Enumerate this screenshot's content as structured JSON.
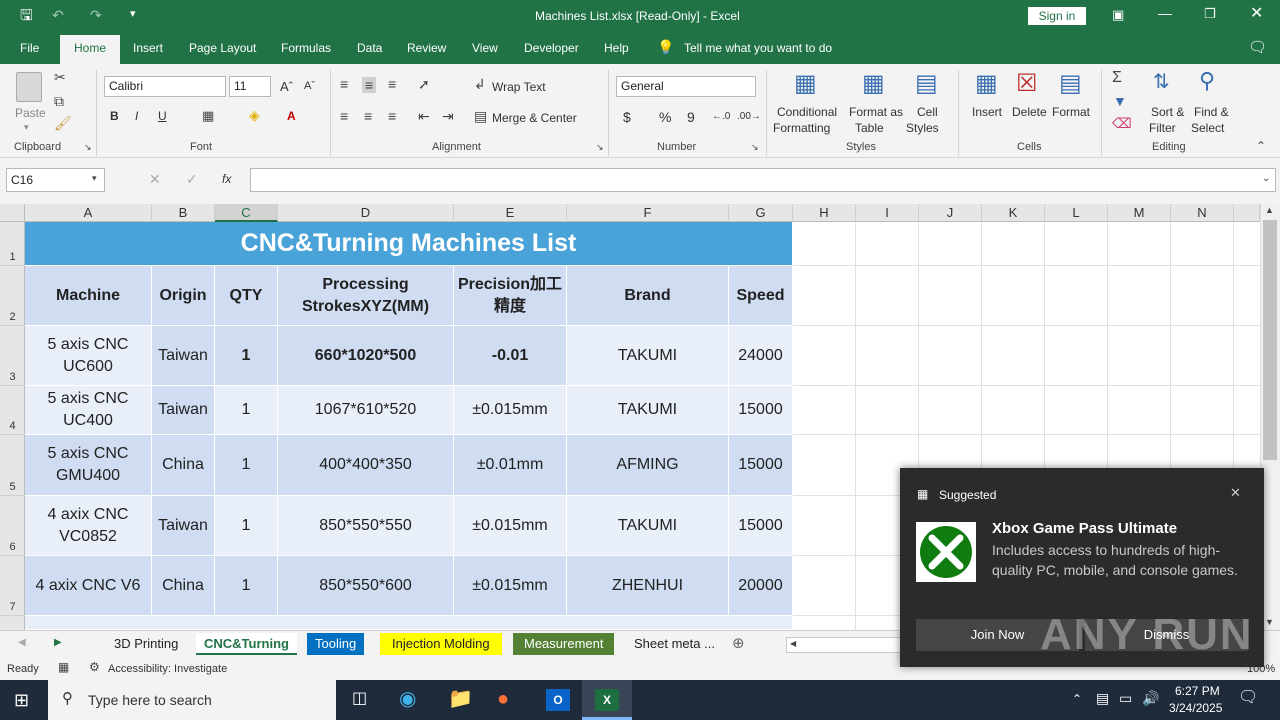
{
  "title": "Machines List.xlsx  [Read-Only]  -  Excel",
  "sign_in": "Sign in",
  "menu_tabs": [
    "File",
    "Home",
    "Insert",
    "Page Layout",
    "Formulas",
    "Data",
    "Review",
    "View",
    "Developer",
    "Help"
  ],
  "tell_me": "Tell me what you want to do",
  "ribbon": {
    "paste": "Paste",
    "font_name": "Calibri",
    "font_size": "11",
    "wrap_text": "Wrap Text",
    "merge_center": "Merge & Center",
    "number_format": "General",
    "conditional": [
      "Conditional",
      "Formatting"
    ],
    "format_table": [
      "Format as",
      "Table"
    ],
    "cell_styles": [
      "Cell",
      "Styles"
    ],
    "insert": "Insert",
    "delete": "Delete",
    "format": "Format",
    "sort_filter": [
      "Sort &",
      "Filter"
    ],
    "find_select": [
      "Find &",
      "Select"
    ],
    "groups": [
      "Clipboard",
      "Font",
      "Alignment",
      "Number",
      "Styles",
      "Cells",
      "Editing"
    ]
  },
  "formula_bar": {
    "name_box": "C16",
    "fx": "fx",
    "formula": ""
  },
  "columns": [
    "A",
    "B",
    "C",
    "D",
    "E",
    "F",
    "G",
    "H",
    "I",
    "J",
    "K",
    "L",
    "M",
    "N"
  ],
  "rows": [
    "1",
    "2",
    "3",
    "4",
    "5",
    "6",
    "7"
  ],
  "sheet": {
    "title": "CNC&Turning Machines List",
    "headers": [
      "Machine",
      "Origin",
      "QTY",
      "Processing StrokesXYZ(MM)",
      "Precision加工精度",
      "Brand",
      "Speed"
    ],
    "data": [
      [
        "5 axis CNC UC600",
        "Taiwan",
        "1",
        "660*1020*500",
        "-0.01",
        "TAKUMI",
        "24000"
      ],
      [
        "5 axis CNC UC400",
        "Taiwan",
        "1",
        "1067*610*520",
        "±0.015mm",
        "TAKUMI",
        "15000"
      ],
      [
        "5 axis CNC GMU400",
        "China",
        "1",
        "400*400*350",
        "±0.01mm",
        "AFMING",
        "15000"
      ],
      [
        "4 axix CNC VC0852",
        "Taiwan",
        "1",
        "850*550*550",
        "±0.015mm",
        "TAKUMI",
        "15000"
      ],
      [
        "4 axix CNC V6",
        "China",
        "1",
        "850*550*600",
        "±0.015mm",
        "ZHENHUI",
        "20000"
      ]
    ]
  },
  "sheet_tabs": [
    {
      "label": "3D Printing",
      "color": "#f3f3f3",
      "text": "#333333"
    },
    {
      "label": "CNC&Turning",
      "color": "#ffffff",
      "text": "#217346"
    },
    {
      "label": "Tooling",
      "color": "#0070c0",
      "text": "#ffffff"
    },
    {
      "label": "Injection Molding",
      "color": "#ffff00",
      "text": "#222222"
    },
    {
      "label": "Measurement",
      "color": "#548235",
      "text": "#ffffff"
    },
    {
      "label": "Sheet meta ...",
      "color": "#f3f3f3",
      "text": "#333333"
    }
  ],
  "status": {
    "ready": "Ready",
    "accessibility": "Accessibility: Investigate",
    "zoom": "100%"
  },
  "toast": {
    "heading": "Suggested",
    "title": "Xbox Game Pass Ultimate",
    "body": "Includes access to hundreds of high-quality PC, mobile, and console games.",
    "join": "Join Now",
    "dismiss": "Dismiss"
  },
  "taskbar": {
    "search": "Type here to search",
    "time": "6:27 PM",
    "date": "3/24/2025"
  },
  "watermark": "ANY RUN",
  "colors": {
    "excel_green": "#217346",
    "title_fill": "#4aa3d8",
    "header_fill": "#cfdcf1",
    "band_dark": "#cfdcf1",
    "band_light": "#e9eff8"
  }
}
